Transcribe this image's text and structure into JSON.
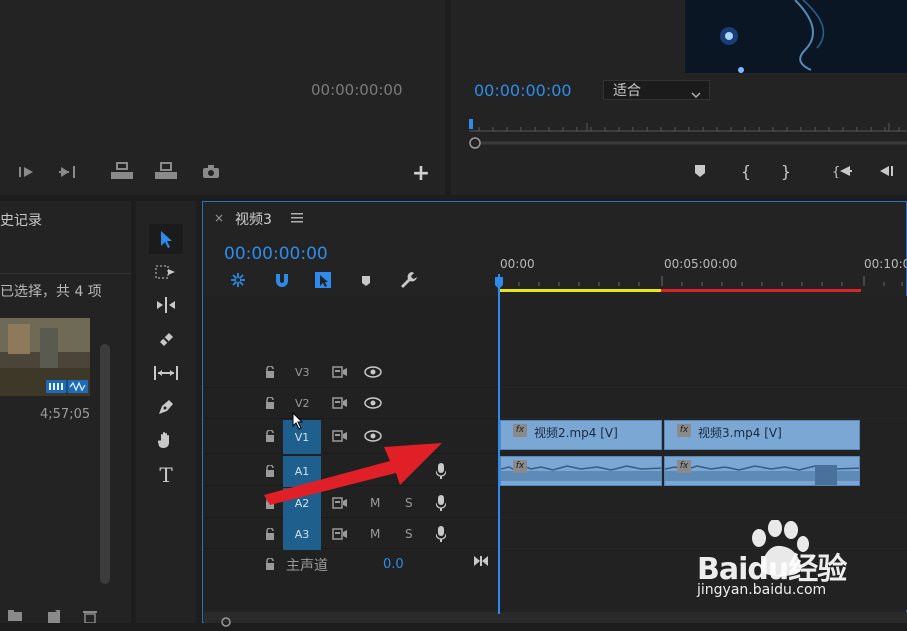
{
  "source_monitor": {
    "timecode": "00:00:00:00"
  },
  "program_monitor": {
    "timecode": "00:00:00:00",
    "fit_select": "适合"
  },
  "project_panel": {
    "tab_label": "史记录",
    "selection_text": "已选择，共 4 项",
    "clip_duration": "4;57;05"
  },
  "timeline": {
    "tab_label": "视频3",
    "timecode": "00:00:00:00",
    "ruler": [
      "00:00",
      "00:05:00:00",
      "00:10:0"
    ],
    "tracks": {
      "v3": "V3",
      "v2": "V2",
      "v1": "V1",
      "a1": "A1",
      "a2": "A2",
      "a3": "A3",
      "m": "M",
      "s": "S"
    },
    "master": {
      "label": "主声道",
      "value": "0.0"
    },
    "clips": [
      {
        "name": "视频2.mp4 [V]"
      },
      {
        "name": "视频3.mp4 [V]"
      }
    ],
    "fx": "fx"
  },
  "watermark": {
    "brand": "Baidu经验",
    "url": "jingyan.baidu.com"
  },
  "colors": {
    "accent": "#2d8ceb",
    "clip": "#7ba7d5",
    "arrow": "#e01f26",
    "render_yellow": "#e6e619",
    "render_red": "#d8242a"
  }
}
